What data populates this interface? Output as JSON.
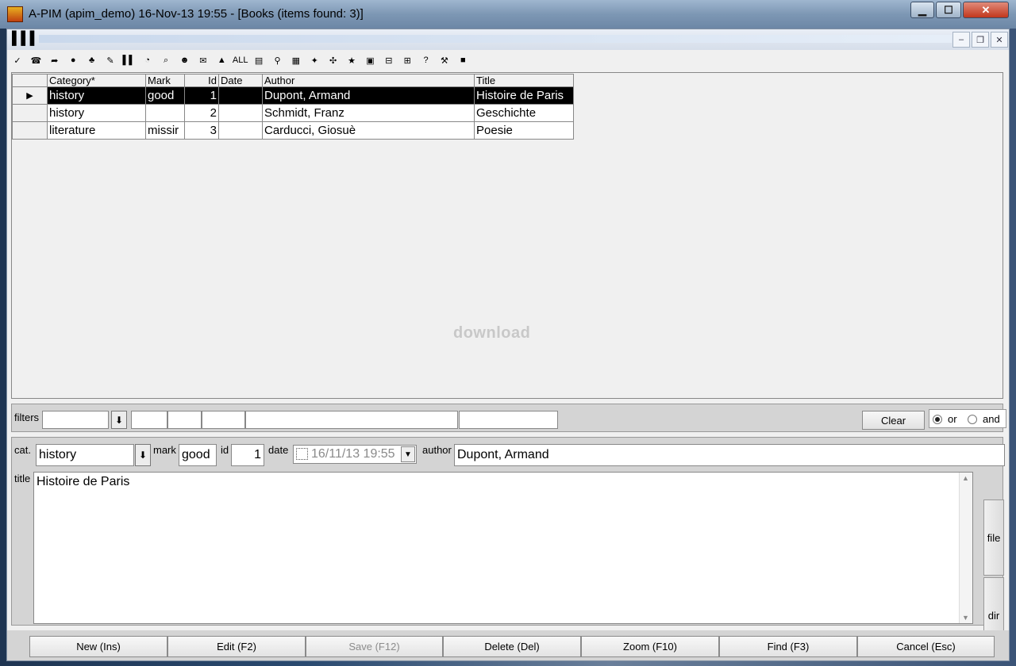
{
  "window": {
    "title": "A-PIM (apim_demo) 16-Nov-13 19:55 - [Books (items found: 3)]",
    "minimize": "▁",
    "maximize": "☐",
    "close": "✕"
  },
  "mdi": {
    "minimize": "–",
    "restore": "❐",
    "close": "✕"
  },
  "toolbar": {
    "icons": [
      "✓",
      "☎",
      "➦",
      "●",
      "♣",
      "✎",
      "▌▌",
      "◔",
      "⌕",
      "☻",
      "✉",
      "▲",
      "ALL",
      "▤",
      "⚲",
      "▦",
      "✦",
      "✣",
      "★",
      "▣",
      "⊟",
      "⊞",
      "?",
      "⚒",
      "■"
    ]
  },
  "grid": {
    "columns": [
      "Category*",
      "Mark",
      "Id",
      "Date",
      "Author",
      "Title"
    ],
    "rows": [
      {
        "indicator": "▶",
        "category": "history",
        "mark": "good",
        "id": "1",
        "date": "",
        "author": "Dupont, Armand",
        "title": "Histoire de Paris"
      },
      {
        "indicator": "",
        "category": "history",
        "mark": "",
        "id": "2",
        "date": "",
        "author": "Schmidt, Franz",
        "title": "Geschichte"
      },
      {
        "indicator": "",
        "category": "literature",
        "mark": "missir",
        "id": "3",
        "date": "",
        "author": "Carducci, Giosuè",
        "title": "Poesie"
      }
    ],
    "watermark": "download"
  },
  "filters": {
    "label": "filters",
    "dropdown_icon": "⬇",
    "clear": "Clear",
    "or_label": "or",
    "and_label": "and",
    "mode": "or"
  },
  "edit": {
    "cat_label": "cat.",
    "cat_value": "history",
    "mark_label": "mark",
    "mark_value": "good",
    "id_label": "id",
    "id_value": "1",
    "date_label": "date",
    "date_value": "16/11/13 19:55",
    "author_label": "author",
    "author_value": "Dupont, Armand",
    "title_label": "title",
    "title_value": "Histoire de Paris",
    "file_button": "file",
    "dir_button": "dir"
  },
  "buttons": {
    "new": "New (Ins)",
    "edit": "Edit (F2)",
    "save": "Save (F12)",
    "delete": "Delete (Del)",
    "zoom": "Zoom (F10)",
    "find": "Find (F3)",
    "cancel": "Cancel (Esc)"
  }
}
